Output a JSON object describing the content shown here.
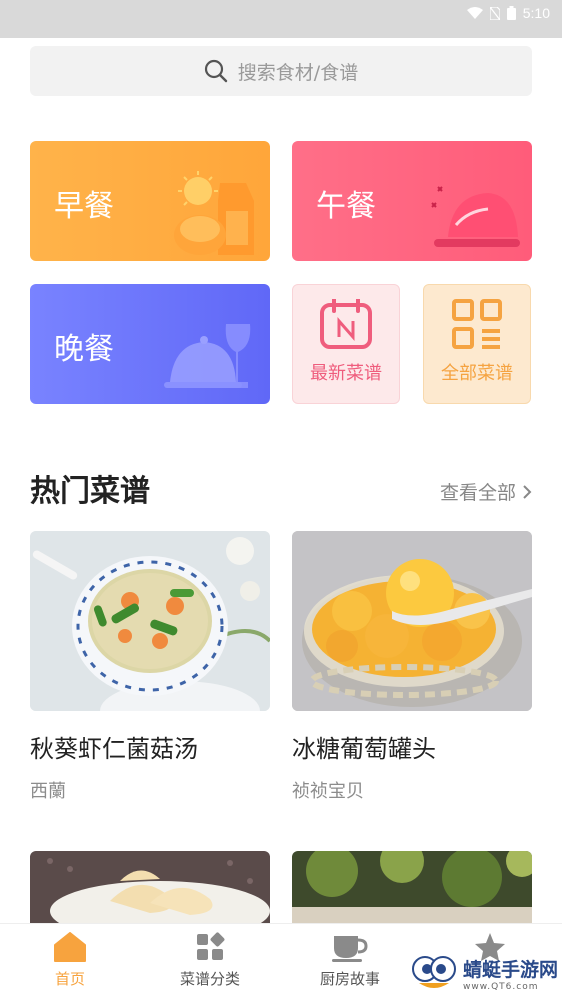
{
  "status_bar": {
    "time": "5:10"
  },
  "search": {
    "placeholder": "搜索食材/食谱"
  },
  "categories": {
    "breakfast": "早餐",
    "lunch": "午餐",
    "dinner": "晚餐",
    "newest": "最新菜谱",
    "all": "全部菜谱"
  },
  "hot": {
    "title": "热门菜谱",
    "see_all": "查看全部",
    "recipes": [
      {
        "title": "秋葵虾仁菌菇汤",
        "author": "西蘭"
      },
      {
        "title": "冰糖葡萄罐头",
        "author": "祯祯宝贝"
      }
    ]
  },
  "tabbar": {
    "tabs": [
      {
        "label": "首页"
      },
      {
        "label": "菜谱分类"
      },
      {
        "label": "厨房故事"
      },
      {
        "label": ""
      }
    ]
  },
  "watermark": {
    "text": "蜻蜓手游网",
    "sub": "www.QT6.com"
  },
  "colors": {
    "accent": "#f7a33e",
    "breakfast": "#ffad42",
    "lunch": "#ff6683",
    "dinner": "#6d75fb"
  }
}
